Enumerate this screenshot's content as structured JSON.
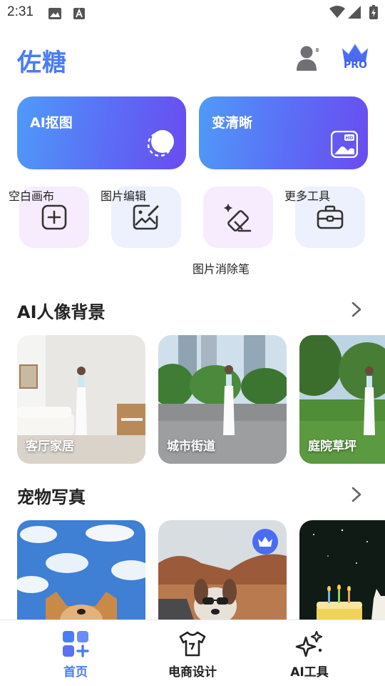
{
  "status_bar": {
    "time": "2:31"
  },
  "header": {
    "brand": "佐糖",
    "pro_label": "PRO"
  },
  "feature_cards": [
    {
      "label": "AI抠图",
      "icon": "cutout-icon"
    },
    {
      "label": "变清晰",
      "icon": "hd-image-icon"
    }
  ],
  "tools": [
    {
      "label": "空白画布",
      "icon": "blank-canvas-icon"
    },
    {
      "label": "图片编辑",
      "icon": "image-edit-icon"
    },
    {
      "label": "图片消除笔",
      "icon": "eraser-icon"
    },
    {
      "label": "更多工具",
      "icon": "toolbox-icon"
    }
  ],
  "sections": {
    "portrait": {
      "title": "AI人像背景",
      "more": ">",
      "items": [
        "客厅家居",
        "城市街道",
        "庭院草坪"
      ]
    },
    "pet": {
      "title": "宠物写真",
      "more": ">"
    }
  },
  "bottom_nav": [
    {
      "label": "首页",
      "active": true,
      "icon": "home-grid-icon"
    },
    {
      "label": "电商设计",
      "active": false,
      "icon": "tshirt-icon"
    },
    {
      "label": "AI工具",
      "active": false,
      "icon": "sparkles-icon"
    }
  ],
  "colors": {
    "brand": "#4a7cf5",
    "card_gradient_start": "#4f9bf8",
    "card_gradient_end": "#6a4cf0",
    "active_nav": "#4a7cf5"
  }
}
